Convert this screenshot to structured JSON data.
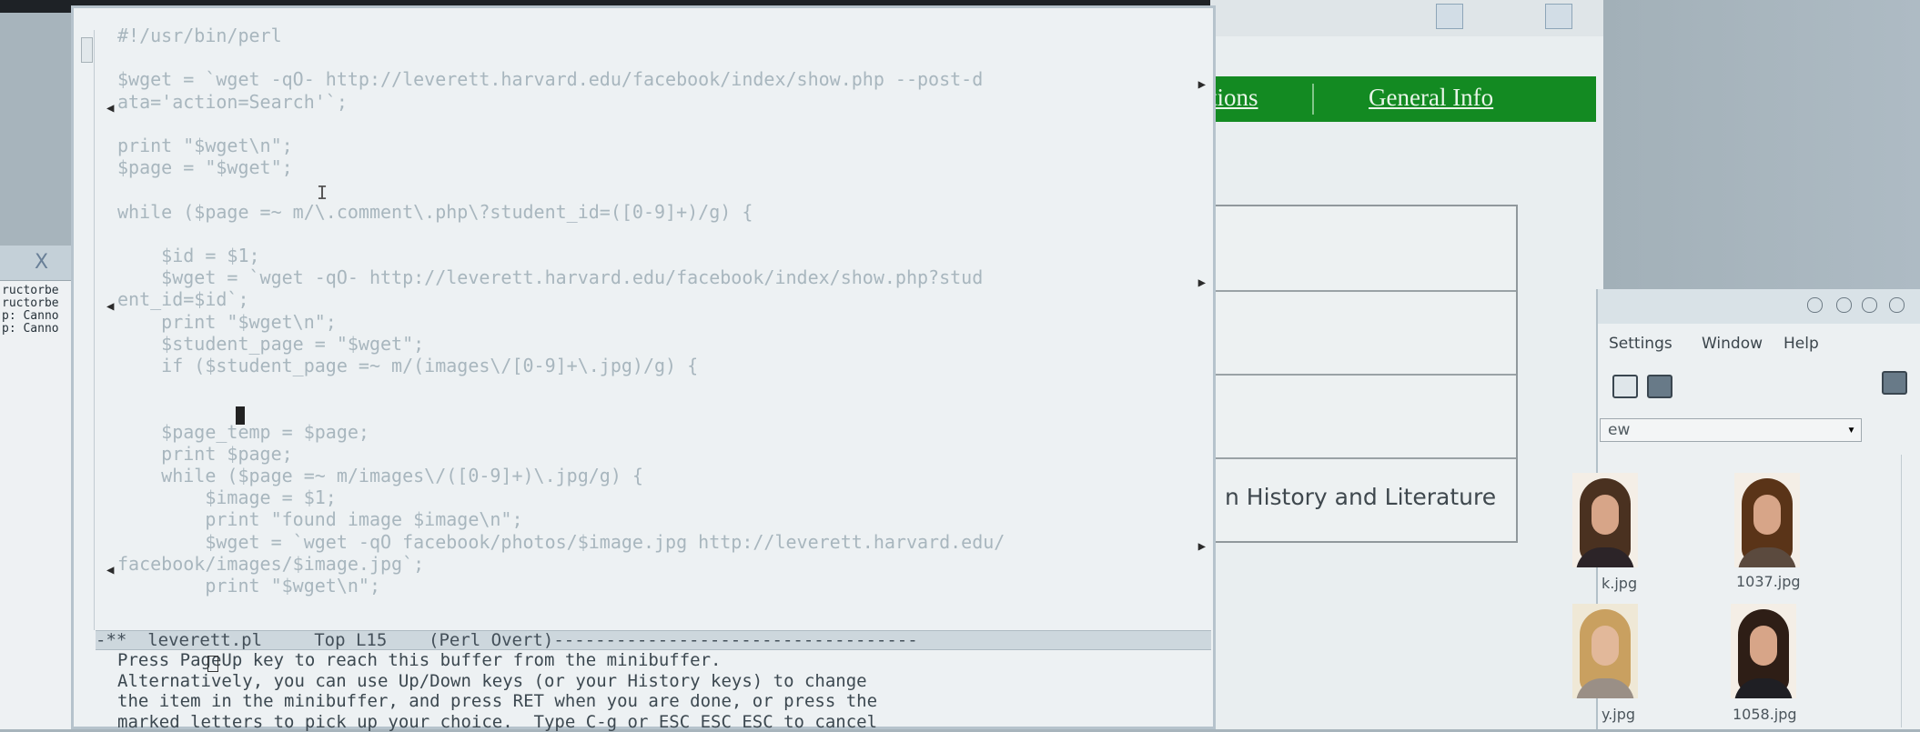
{
  "terminal": {
    "title_icon": "X",
    "lines": [
      "ructorbe",
      "ructorbe",
      "p: Canno",
      "p: Canno"
    ]
  },
  "browser": {
    "nav": {
      "item_partial": "tions",
      "general_info": "General Info"
    },
    "history_text": "n History and Literature"
  },
  "editor": {
    "code_lines": [
      "#!/usr/bin/perl",
      "",
      "$wget = `wget -qO- http://leverett.harvard.edu/facebook/index/show.php --post-d",
      "ata='action=Search'`;",
      "",
      "print \"$wget\\n\";",
      "$page = \"$wget\";",
      "",
      "while ($page =~ m/\\.comment\\.php\\?student_id=([0-9]+)/g) {",
      "",
      "    $id = $1;",
      "    $wget = `wget -qO- http://leverett.harvard.edu/facebook/index/show.php?stud",
      "ent_id=$id`;",
      "    print \"$wget\\n\";",
      "    $student_page = \"$wget\";",
      "    if ($student_page =~ m/(images\\/[0-9]+\\.jpg)/g) {",
      "",
      "",
      "    $page_temp = $page;",
      "    print $page;",
      "    while ($page =~ m/images\\/([0-9]+)\\.jpg/g) {",
      "        $image = $1;",
      "        print \"found image $image\\n\";",
      "        $wget = `wget -qO facebook/photos/$image.jpg http://leverett.harvard.edu/",
      "facebook/images/$image.jpg`;",
      "        print \"$wget\\n\";"
    ],
    "modeline": "-**  leverett.pl     Top L15    (Perl Overt)-----------------------------------",
    "minibuffer": [
      "Press PageUp key to reach this buffer from the minibuffer.",
      "Alternatively, you can use Up/Down keys (or your History keys) to change",
      "the item in the minibuffer, and press RET when you are done, or press the",
      "marked letters to pick up your choice.  Type C-g or ESC ESC ESC to cancel"
    ]
  },
  "viewer": {
    "menu": [
      "Settings",
      "Window",
      "Help"
    ],
    "path_value": "ew",
    "thumbnails": [
      {
        "caption": "1037.jpg"
      },
      {
        "caption": "1058.jpg"
      }
    ],
    "partial_captions": [
      "k.jpg",
      "y.jpg"
    ]
  },
  "colors": {
    "nav_green": "#138a22",
    "editor_bg": "#edf1f3"
  }
}
